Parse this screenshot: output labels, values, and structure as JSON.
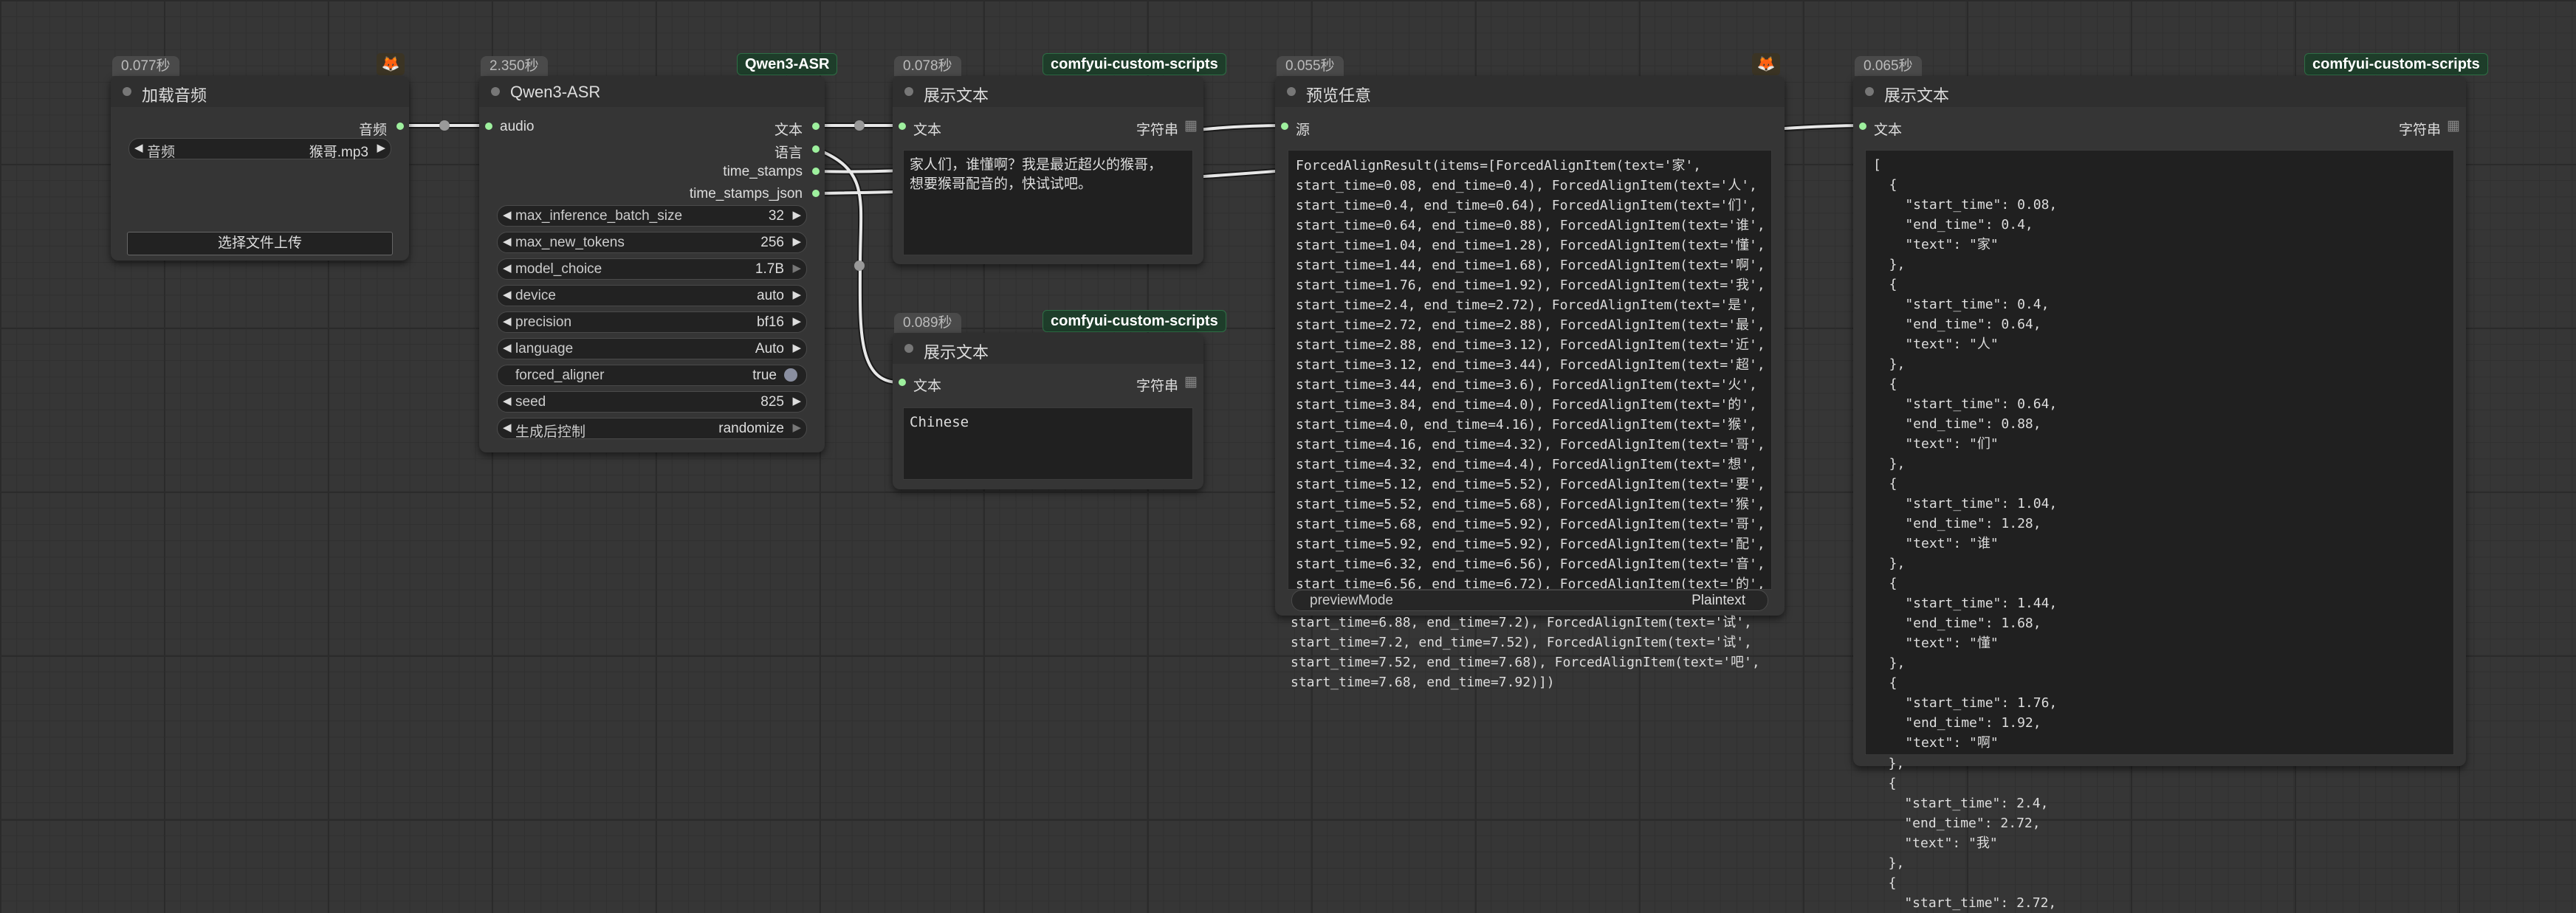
{
  "colors": {
    "link": "#e8e8e8",
    "pin": "#9ef09e",
    "tag_bg": "#1e3d2a",
    "canvas": "#363636"
  },
  "nodes": {
    "load_audio": {
      "time": "0.077秒",
      "title": "加载音频",
      "output_audio": "音频",
      "audio_label": "音频",
      "audio_value": "猴哥.mp3",
      "upload_label": "选择文件上传",
      "badge_icon": "fox-icon"
    },
    "asr": {
      "time": "2.350秒",
      "tag": "Qwen3-ASR",
      "title": "Qwen3-ASR",
      "input_audio": "audio",
      "outputs": [
        "文本",
        "语言",
        "time_stamps",
        "time_stamps_json"
      ],
      "widgets": [
        {
          "label": "max_inference_batch_size",
          "value": "32"
        },
        {
          "label": "max_new_tokens",
          "value": "256"
        },
        {
          "label": "model_choice",
          "value": "1.7B"
        },
        {
          "label": "device",
          "value": "auto"
        },
        {
          "label": "precision",
          "value": "bf16"
        },
        {
          "label": "language",
          "value": "Auto"
        },
        {
          "label": "forced_aligner",
          "value": "true"
        },
        {
          "label": "seed",
          "value": "825"
        },
        {
          "label": "生成后控制",
          "value": "randomize"
        }
      ]
    },
    "show_text_1": {
      "time": "0.078秒",
      "tag": "comfyui-custom-scripts",
      "title": "展示文本",
      "input": "文本",
      "output": "字符串",
      "lines": [
        "家人们，谁懂啊？我是最近超火的猴哥，",
        "想要猴哥配音的，快试试吧。"
      ]
    },
    "show_text_2": {
      "time": "0.089秒",
      "tag": "comfyui-custom-scripts",
      "title": "展示文本",
      "input": "文本",
      "output": "字符串",
      "text": "Chinese"
    },
    "preview_any": {
      "time": "0.055秒",
      "title": "预览任意",
      "input": "源",
      "preview_mode_label": "previewMode",
      "preview_mode_value": "Plaintext",
      "badge_icon": "fox-icon",
      "lines": [
        "ForcedAlignResult(items=[ForcedAlignItem(text='家',",
        "start_time=0.08, end_time=0.4), ForcedAlignItem(text='人',",
        "start_time=0.4, end_time=0.64), ForcedAlignItem(text='们',",
        "start_time=0.64, end_time=0.88), ForcedAlignItem(text='谁',",
        "start_time=1.04, end_time=1.28), ForcedAlignItem(text='懂',",
        "start_time=1.44, end_time=1.68), ForcedAlignItem(text='啊',",
        "start_time=1.76, end_time=1.92), ForcedAlignItem(text='我',",
        "start_time=2.4, end_time=2.72), ForcedAlignItem(text='是',",
        "start_time=2.72, end_time=2.88), ForcedAlignItem(text='最',",
        "start_time=2.88, end_time=3.12), ForcedAlignItem(text='近',",
        "start_time=3.12, end_time=3.44), ForcedAlignItem(text='超',",
        "start_time=3.44, end_time=3.6), ForcedAlignItem(text='火',",
        "start_time=3.84, end_time=4.0), ForcedAlignItem(text='的',",
        "start_time=4.0, end_time=4.16), ForcedAlignItem(text='猴',",
        "start_time=4.16, end_time=4.32), ForcedAlignItem(text='哥',",
        "start_time=4.32, end_time=4.4), ForcedAlignItem(text='想',",
        "start_time=5.12, end_time=5.52), ForcedAlignItem(text='要',",
        "start_time=5.52, end_time=5.68), ForcedAlignItem(text='猴',",
        "start_time=5.68, end_time=5.92), ForcedAlignItem(text='哥',",
        "start_time=5.92, end_time=5.92), ForcedAlignItem(text='配',",
        "start_time=6.32, end_time=6.56), ForcedAlignItem(text='音',",
        "start_time=6.56, end_time=6.72), ForcedAlignItem(text='的',"
      ],
      "overflow_lines": [
        "start_time=6.88, end_time=7.2), ForcedAlignItem(text='试',",
        "start_time=7.2, end_time=7.52), ForcedAlignItem(text='试',",
        "start_time=7.52, end_time=7.68), ForcedAlignItem(text='吧',",
        "start_time=7.68, end_time=7.92)])"
      ]
    },
    "show_text_3": {
      "time": "0.065秒",
      "tag": "comfyui-custom-scripts",
      "title": "展示文本",
      "input": "文本",
      "output": "字符串",
      "lines": [
        "[",
        "  {",
        "    \"start_time\": 0.08,",
        "    \"end_time\": 0.4,",
        "    \"text\": \"家\"",
        "  },",
        "  {",
        "    \"start_time\": 0.4,",
        "    \"end_time\": 0.64,",
        "    \"text\": \"人\"",
        "  },",
        "  {",
        "    \"start_time\": 0.64,",
        "    \"end_time\": 0.88,",
        "    \"text\": \"们\"",
        "  },",
        "  {",
        "    \"start_time\": 1.04,",
        "    \"end_time\": 1.28,",
        "    \"text\": \"谁\"",
        "  },",
        "  {",
        "    \"start_time\": 1.44,",
        "    \"end_time\": 1.68,",
        "    \"text\": \"懂\"",
        "  },",
        "  {",
        "    \"start_time\": 1.76,",
        "    \"end_time\": 1.92,",
        "    \"text\": \"啊\""
      ],
      "overflow_lines": [
        "  },",
        "  {",
        "    \"start_time\": 2.4,",
        "    \"end_time\": 2.72,",
        "    \"text\": \"我\"",
        "  },",
        "  {",
        "    \"start_time\": 2.72,"
      ]
    }
  }
}
